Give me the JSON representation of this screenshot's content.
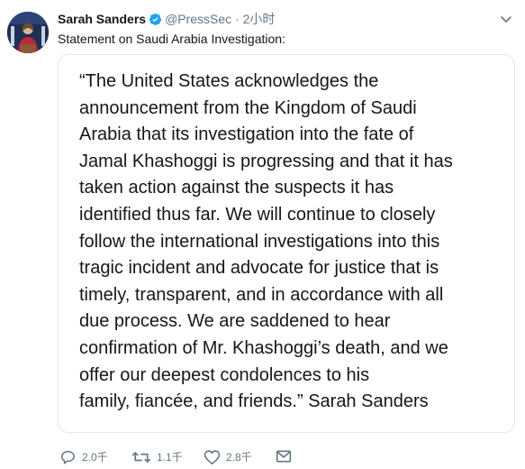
{
  "tweet": {
    "author_name": "Sarah Sanders",
    "handle": "@PressSec",
    "separator": "·",
    "time": "2小时",
    "text": "Statement on Saudi Arabia Investigation:",
    "image_text_lines": [
      "“The United States acknowledges the",
      "announcement from the Kingdom of Saudi",
      "Arabia that its investigation into the fate of",
      "Jamal Khashoggi is progressing and that it has",
      "taken action against the suspects it has",
      "identified thus far. We will continue to closely",
      "follow the international investigations into this",
      "tragic incident and advocate for justice that is",
      "timely, transparent, and in accordance with all",
      "due process. We are saddened to hear",
      "confirmation of Mr. Khashoggi’s death, and we",
      "offer our deepest condolences to his",
      "family, fiancée, and friends.” Sarah Sanders"
    ]
  },
  "actions": {
    "reply_count": "2.0千",
    "retweet_count": "1.1千",
    "like_count": "2.8千"
  },
  "icons": {
    "verified": "verified-badge-icon",
    "menu": "chevron-down-icon",
    "reply": "reply-icon",
    "retweet": "retweet-icon",
    "like": "heart-icon",
    "dm": "envelope-icon"
  },
  "colors": {
    "verified_blue": "#1da1f2",
    "secondary_text": "#657786",
    "border": "#e1e8ed"
  }
}
